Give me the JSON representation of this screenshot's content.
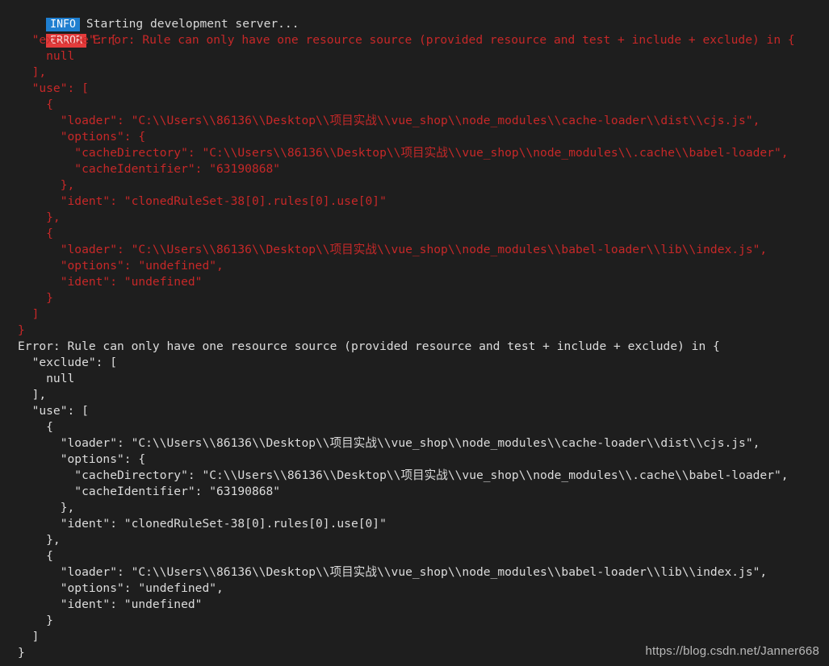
{
  "terminal": {
    "background_color": "#1e1e1e",
    "info_badge": {
      "label": "INFO",
      "bg_color": "#1f7fd0",
      "text_color": "#ffffff"
    },
    "error_badge": {
      "label": "ERROR",
      "bg_color": "#e33b3b",
      "text_color": "#f3d9d9"
    },
    "info_message": "Starting development server...",
    "error_message": "Error: Rule can only have one resource source (provided resource and test + include + exclude) in {",
    "error_text_color": "#c62828",
    "plain_text_color": "#dcdcdc",
    "block_error_lines": [
      "  \"exclude\": [",
      "    null",
      "  ],",
      "  \"use\": [",
      "    {",
      "      \"loader\": \"C:\\\\Users\\\\86136\\\\Desktop\\\\项目实战\\\\vue_shop\\\\node_modules\\\\cache-loader\\\\dist\\\\cjs.js\",",
      "      \"options\": {",
      "        \"cacheDirectory\": \"C:\\\\Users\\\\86136\\\\Desktop\\\\项目实战\\\\vue_shop\\\\node_modules\\\\.cache\\\\babel-loader\",",
      "        \"cacheIdentifier\": \"63190868\"",
      "      },",
      "      \"ident\": \"clonedRuleSet-38[0].rules[0].use[0]\"",
      "    },",
      "    {",
      "      \"loader\": \"C:\\\\Users\\\\86136\\\\Desktop\\\\项目实战\\\\vue_shop\\\\node_modules\\\\babel-loader\\\\lib\\\\index.js\",",
      "      \"options\": \"undefined\",",
      "      \"ident\": \"undefined\"",
      "    }",
      "  ]",
      "}"
    ],
    "plain_header_line": "Error: Rule can only have one resource source (provided resource and test + include + exclude) in {",
    "block_plain_lines": [
      "  \"exclude\": [",
      "    null",
      "  ],",
      "  \"use\": [",
      "    {",
      "      \"loader\": \"C:\\\\Users\\\\86136\\\\Desktop\\\\项目实战\\\\vue_shop\\\\node_modules\\\\cache-loader\\\\dist\\\\cjs.js\",",
      "      \"options\": {",
      "        \"cacheDirectory\": \"C:\\\\Users\\\\86136\\\\Desktop\\\\项目实战\\\\vue_shop\\\\node_modules\\\\.cache\\\\babel-loader\",",
      "        \"cacheIdentifier\": \"63190868\"",
      "      },",
      "      \"ident\": \"clonedRuleSet-38[0].rules[0].use[0]\"",
      "    },",
      "    {",
      "      \"loader\": \"C:\\\\Users\\\\86136\\\\Desktop\\\\项目实战\\\\vue_shop\\\\node_modules\\\\babel-loader\\\\lib\\\\index.js\",",
      "      \"options\": \"undefined\",",
      "      \"ident\": \"undefined\"",
      "    }",
      "  ]",
      "}"
    ],
    "watermark": "https://blog.csdn.net/Janner668"
  }
}
